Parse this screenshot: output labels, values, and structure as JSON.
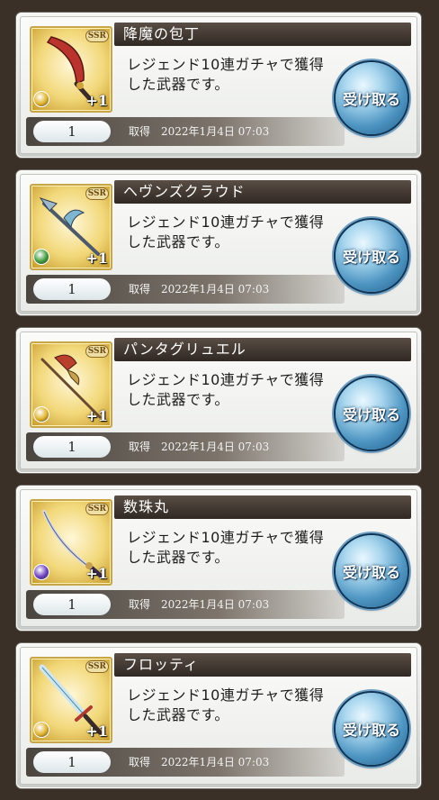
{
  "list": {
    "items": [
      {
        "name": "降魔の包丁",
        "description": "レジェンド10連ガチャで獲得した武器です。",
        "quantity": "1",
        "obtained_label": "取得",
        "obtained_date": "2022年1月4日 07:03",
        "rarity": "SSR",
        "plus": "+1",
        "element_color": "#e0b22a",
        "weapon_icon": "cleaver-blade-icon",
        "receive_label": "受け取る"
      },
      {
        "name": "ヘヴンズクラウド",
        "description": "レジェンド10連ガチャで獲得した武器です。",
        "quantity": "1",
        "obtained_label": "取得",
        "obtained_date": "2022年1月4日 07:03",
        "rarity": "SSR",
        "plus": "+1",
        "element_color": "#3e9a3a",
        "weapon_icon": "spear-icon",
        "receive_label": "受け取る"
      },
      {
        "name": "パンタグリュエル",
        "description": "レジェンド10連ガチャで獲得した武器です。",
        "quantity": "1",
        "obtained_label": "取得",
        "obtained_date": "2022年1月4日 07:03",
        "rarity": "SSR",
        "plus": "+1",
        "element_color": "#e0b22a",
        "weapon_icon": "axe-spear-icon",
        "receive_label": "受け取る"
      },
      {
        "name": "数珠丸",
        "description": "レジェンド10連ガチャで獲得した武器です。",
        "quantity": "1",
        "obtained_label": "取得",
        "obtained_date": "2022年1月4日 07:03",
        "rarity": "SSR",
        "plus": "+1",
        "element_color": "#6b3fc0",
        "weapon_icon": "katana-icon",
        "receive_label": "受け取る"
      },
      {
        "name": "フロッティ",
        "description": "レジェンド10連ガチャで獲得した武器です。",
        "quantity": "1",
        "obtained_label": "取得",
        "obtained_date": "2022年1月4日 07:03",
        "rarity": "SSR",
        "plus": "+1",
        "element_color": "#e0b22a",
        "weapon_icon": "sword-icon",
        "receive_label": "受け取る"
      }
    ]
  }
}
